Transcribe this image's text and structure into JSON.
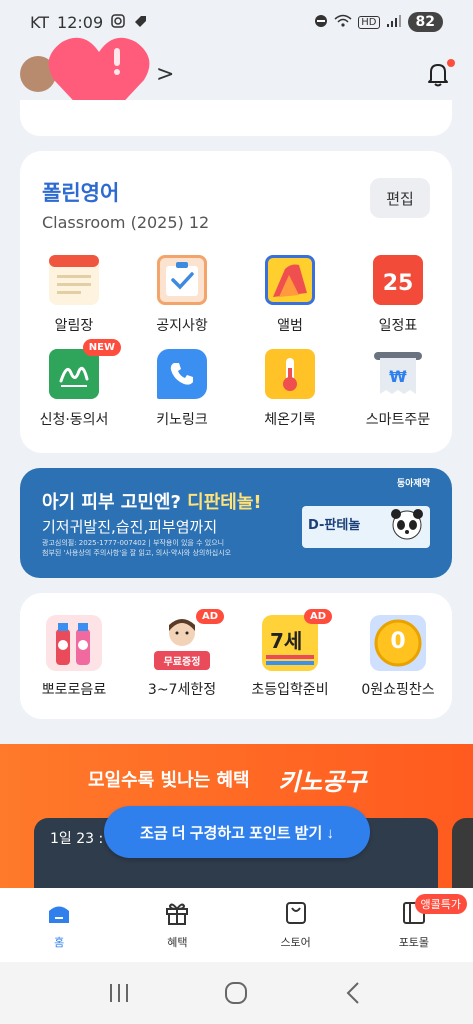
{
  "status_bar": {
    "carrier": "KT",
    "time": "12:09",
    "battery": "82",
    "hd": "HD"
  },
  "header": {
    "chevron": ">"
  },
  "class_card": {
    "name": "폴린영어",
    "subtitle": "Classroom (2025) 12",
    "edit_label": "편집",
    "calendar_date": "25",
    "items": [
      {
        "label": "알림장",
        "icon": "notebook-icon"
      },
      {
        "label": "공지사항",
        "icon": "checklist-icon"
      },
      {
        "label": "앨범",
        "icon": "album-icon"
      },
      {
        "label": "일정표",
        "icon": "calendar-icon"
      },
      {
        "label": "신청·동의서",
        "icon": "signature-icon",
        "badge": "NEW"
      },
      {
        "label": "키노링크",
        "icon": "phone-icon"
      },
      {
        "label": "체온기록",
        "icon": "thermometer-icon"
      },
      {
        "label": "스마트주문",
        "icon": "receipt-icon"
      }
    ]
  },
  "ad_banner": {
    "title_prefix": "아기 피부 고민엔? ",
    "title_highlight": "디판테놀!",
    "subtitle": "기저귀발진,습진,피부염까지",
    "fine1": "광고심의필: 2025-1777-007402 | 부작용이 있을 수 있으니",
    "fine2": "첨부된 '사용상의 주의사항'을 잘 읽고, 의사·약사와 상의하십시오",
    "brand": "동아제약",
    "product": "D-판테놀"
  },
  "shopping": {
    "items": [
      {
        "label": "뽀로로음료",
        "icon": "drink-icon"
      },
      {
        "label": "3~7세한정",
        "icon": "child-icon",
        "badge": "AD",
        "tag": "무료증정"
      },
      {
        "label": "초등입학준비",
        "icon": "book-icon",
        "badge": "AD",
        "tag": "7세"
      },
      {
        "label": "0원쇼핑찬스",
        "icon": "coin-icon",
        "tag": "0"
      }
    ]
  },
  "promo": {
    "title": "모일수록 빛나는 혜택",
    "brand": "키노공구",
    "date": "1일 23 :",
    "cta": "조금 더 구경하고 포인트 받기 ↓"
  },
  "bottom_nav": {
    "items": [
      {
        "label": "홈",
        "icon": "home-icon",
        "active": true
      },
      {
        "label": "혜택",
        "icon": "gift-icon"
      },
      {
        "label": "스토어",
        "icon": "shopping-bag-icon"
      },
      {
        "label": "포토몰",
        "icon": "photo-book-icon",
        "badge": "앵콜특가"
      }
    ]
  },
  "colors": {
    "accent": "#2f80ed",
    "title_blue": "#2d6bd0",
    "badge_red": "#ff4d3d",
    "promo_orange": "#ff6a24",
    "banner_blue": "#2c71b3"
  }
}
